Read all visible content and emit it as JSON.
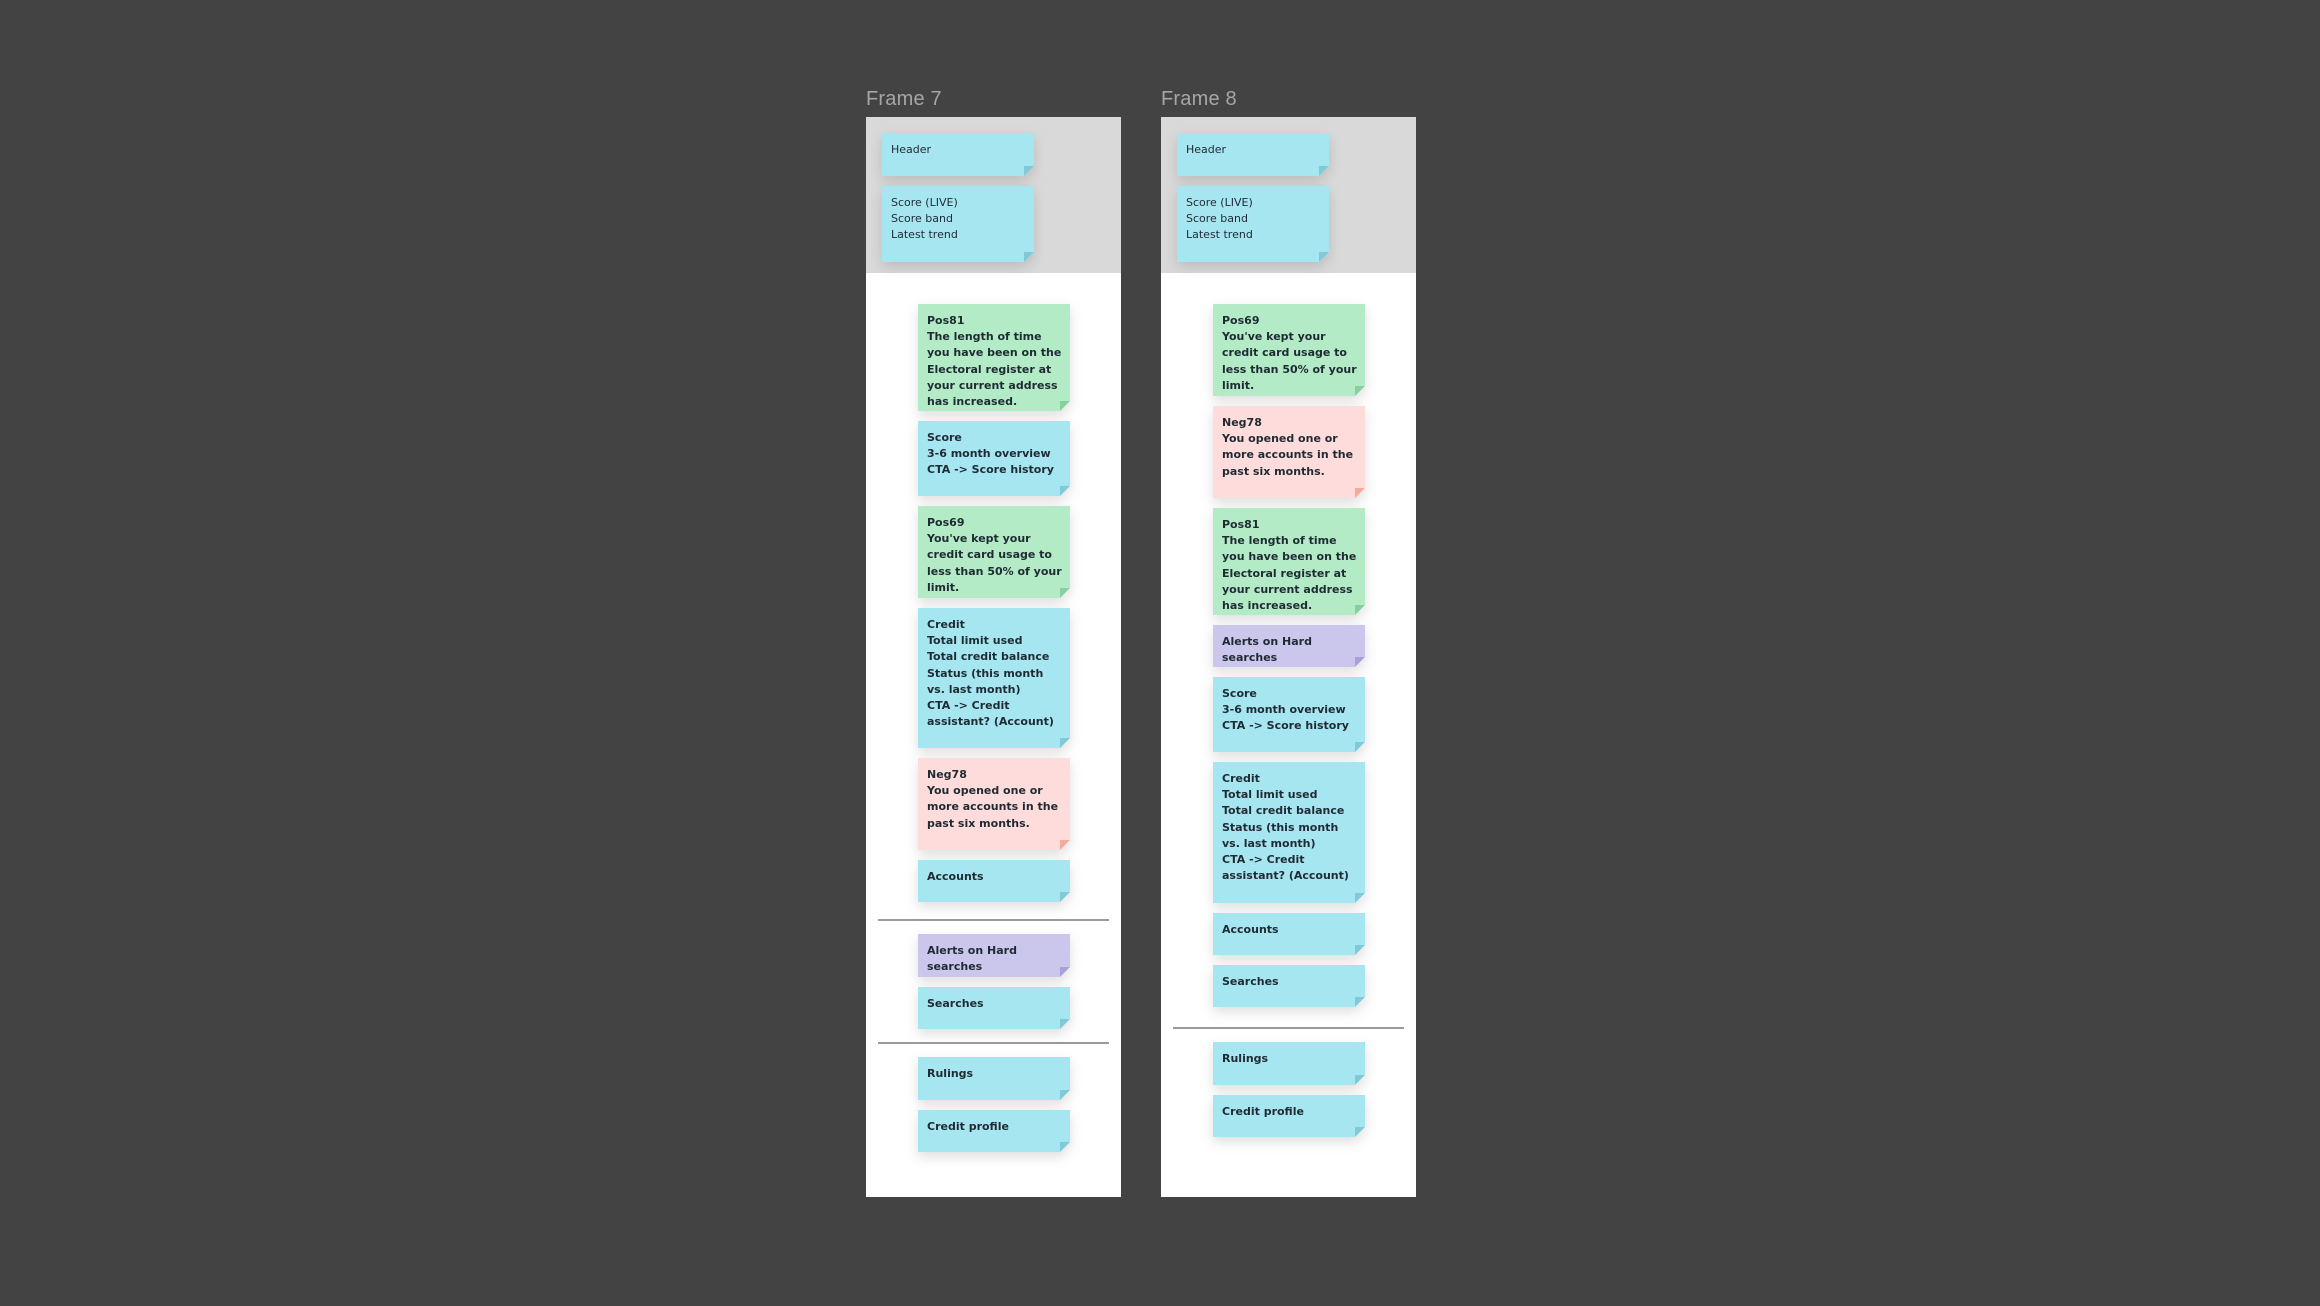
{
  "canvas": {
    "background": "#434343"
  },
  "colors": {
    "blue_note": "#a6e6f1",
    "green_note": "#b2ebc6",
    "pink_note": "#ffdcdc",
    "purple_note": "#cbc6ec",
    "header_band": "#d9d9d9",
    "frame_label": "#a6a6a6"
  },
  "frames": [
    {
      "title": "Frame 7",
      "header_notes": [
        {
          "text": "Header"
        },
        {
          "text": "Score (LIVE)\nScore band\nLatest trend"
        }
      ],
      "notes": [
        {
          "color": "green",
          "text": "Pos81\nThe length of time you have been on the Electoral register at your current address has increased."
        },
        {
          "color": "blue",
          "text": "Score\n3-6 month overview\nCTA -> Score history"
        },
        {
          "color": "green",
          "text": "Pos69\nYou've kept your credit card usage to less than 50% of your limit."
        },
        {
          "color": "blue",
          "text": "Credit\nTotal limit used\nTotal credit balance\nStatus (this month vs. last month)\nCTA -> Credit assistant? (Account)"
        },
        {
          "color": "pink",
          "text": "Neg78\nYou opened one or more accounts in the past six months."
        },
        {
          "color": "blue",
          "text": "Accounts"
        },
        {
          "color": "purple",
          "text": "Alerts on Hard searches"
        },
        {
          "color": "blue",
          "text": "Searches"
        },
        {
          "color": "blue",
          "text": "Rulings"
        },
        {
          "color": "blue",
          "text": "Credit profile"
        }
      ]
    },
    {
      "title": "Frame 8",
      "header_notes": [
        {
          "text": "Header"
        },
        {
          "text": "Score (LIVE)\nScore band\nLatest trend"
        }
      ],
      "notes": [
        {
          "color": "green",
          "text": "Pos69\nYou've kept your credit card usage to less than 50% of your limit."
        },
        {
          "color": "pink",
          "text": "Neg78\nYou opened one or more accounts in the past six months."
        },
        {
          "color": "green",
          "text": "Pos81\nThe length of time you have been on the Electoral register at your current address has increased."
        },
        {
          "color": "purple",
          "text": "Alerts on Hard searches"
        },
        {
          "color": "blue",
          "text": "Score\n3-6 month overview\nCTA -> Score history"
        },
        {
          "color": "blue",
          "text": "Credit\nTotal limit used\nTotal credit balance\nStatus (this month vs. last month)\nCTA -> Credit assistant? (Account)"
        },
        {
          "color": "blue",
          "text": "Accounts"
        },
        {
          "color": "blue",
          "text": "Searches"
        },
        {
          "color": "blue",
          "text": "Rulings"
        },
        {
          "color": "blue",
          "text": "Credit profile"
        }
      ]
    }
  ]
}
